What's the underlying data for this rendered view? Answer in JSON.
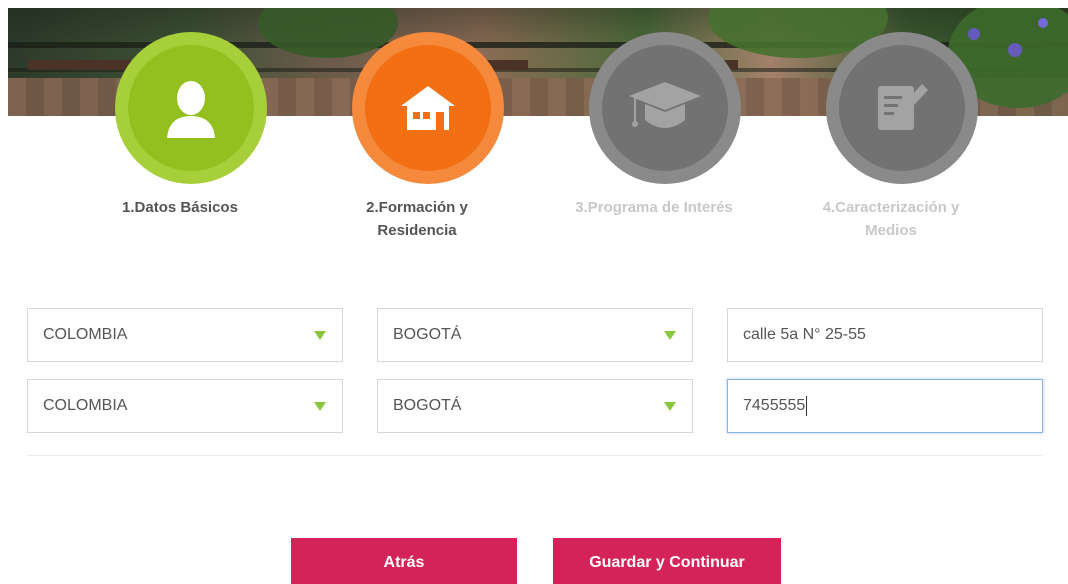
{
  "steps": [
    {
      "label_line1": "1.Datos Básicos",
      "label_line2": "",
      "state": "completed",
      "icon": "user-icon"
    },
    {
      "label_line1": "2.Formación y",
      "label_line2": "Residencia",
      "state": "active",
      "icon": "house-icon"
    },
    {
      "label_line1": "3.Programa de Interés",
      "label_line2": "",
      "state": "inactive",
      "icon": "graduation-cap-icon"
    },
    {
      "label_line1": "4.Caracterización y",
      "label_line2": "Medios",
      "state": "inactive",
      "icon": "edit-document-icon"
    }
  ],
  "form": {
    "row1": {
      "country": "COLOMBIA",
      "city": "BOGOTÁ",
      "address": "calle 5a N° 25-55"
    },
    "row2": {
      "country": "COLOMBIA",
      "city": "BOGOTÁ",
      "phone": "7455555"
    }
  },
  "buttons": {
    "back": "Atrás",
    "save_continue": "Guardar y Continuar"
  },
  "colors": {
    "step_completed": "#93c01f",
    "step_active": "#f27013",
    "step_inactive": "#727272",
    "select_caret": "#8cc63f",
    "button": "#d32358"
  }
}
